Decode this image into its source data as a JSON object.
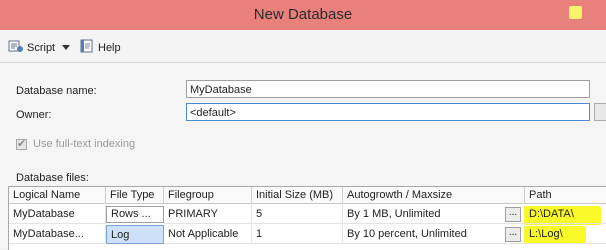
{
  "window": {
    "title": "New Database"
  },
  "toolbar": {
    "script_label": "Script",
    "help_label": "Help"
  },
  "form": {
    "db_name_label": "Database name:",
    "db_name_value": "MyDatabase",
    "owner_label": "Owner:",
    "owner_value": "<default>",
    "fulltext_label": "Use full-text indexing",
    "fulltext_checked": true,
    "files_label": "Database files:"
  },
  "grid": {
    "columns": [
      "Logical Name",
      "File Type",
      "Filegroup",
      "Initial Size (MB)",
      "Autogrowth / Maxsize",
      "Path"
    ],
    "rows": [
      {
        "logical_name": "MyDatabase",
        "file_type": "Rows ...",
        "filegroup": "PRIMARY",
        "initial_size": "5",
        "autogrowth": "By 1 MB, Unlimited",
        "more": "...",
        "path": "D:\\DATA\\"
      },
      {
        "logical_name": "MyDatabase...",
        "file_type": "Log",
        "filegroup": "Not Applicable",
        "initial_size": "1",
        "autogrowth": "By 10 percent, Unlimited",
        "more": "...",
        "path": "L:\\Log\\"
      }
    ]
  },
  "colors": {
    "titlebar": "#e8817c",
    "highlight": "#fafa2a"
  }
}
